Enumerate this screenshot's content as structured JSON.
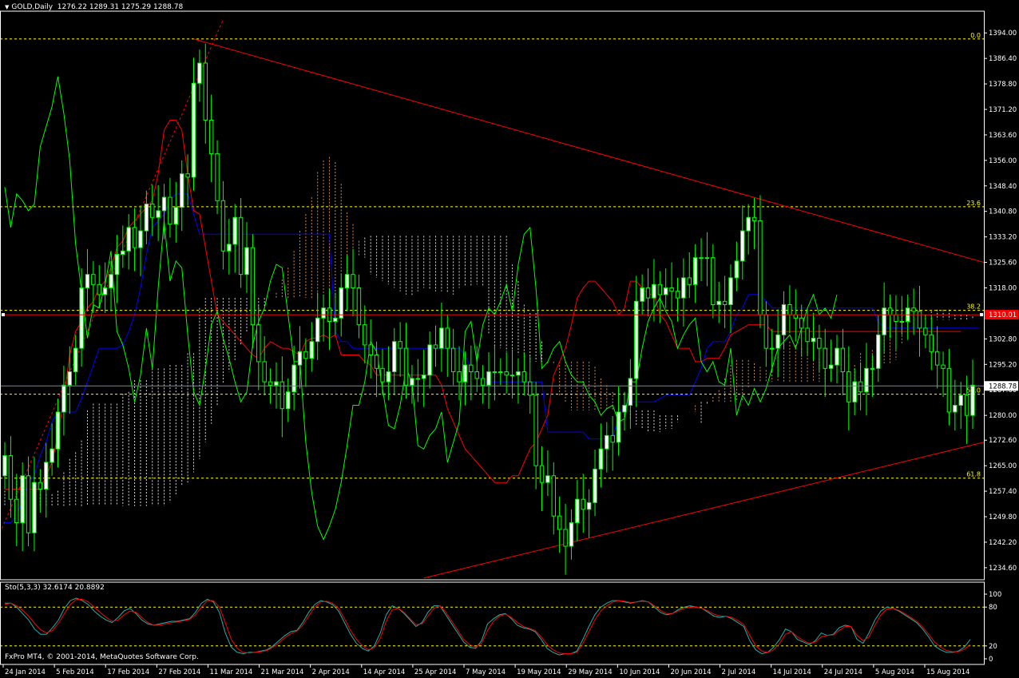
{
  "header": {
    "symbol": "GOLD,Daily",
    "ohlc": "1276.22 1289.31 1275.29 1288.78"
  },
  "subwindow": {
    "label": "Sto(5,3,3) 32.6174 20.8892",
    "levels": [
      "100",
      "80",
      "20",
      "0"
    ]
  },
  "footer": {
    "copyright": "FxPro MT4, © 2001-2014, MetaQuotes Software Corp."
  },
  "colors": {
    "background": "#000000",
    "bull": "#ffffff",
    "bear": "#000000",
    "candle_outline": "#00ff00",
    "tenkan": "#ff0000",
    "kijun": "#0000ff",
    "chikou": "#00ff00",
    "kumo_a": "#f4a460",
    "kumo_b": "#ffffff",
    "fibo": "#ffff00",
    "trendline": "#ff0000",
    "stoch_main": "#20b2aa",
    "stoch_signal": "#ff0000"
  },
  "fibo_levels": [
    {
      "label": "0.0",
      "price": 1392.2
    },
    {
      "label": "23.6",
      "price": 1342.2
    },
    {
      "label": "38.2",
      "price": 1311.3
    },
    {
      "label": "50.0",
      "price": 1286.3
    },
    {
      "label": "61.8",
      "price": 1261.3
    }
  ],
  "price_marks": {
    "red_line": {
      "label": "1310.01",
      "price": 1310.01
    },
    "bid": {
      "label": "1288.78",
      "price": 1288.78
    }
  },
  "chart_data": {
    "type": "candlestick",
    "ylim": [
      1231,
      1400
    ],
    "y_ticks": [
      "1394.00",
      "1386.40",
      "1378.80",
      "1371.20",
      "1363.60",
      "1356.00",
      "1348.40",
      "1340.80",
      "1333.20",
      "1325.60",
      "1318.00",
      "1310.40",
      "1302.80",
      "1295.20",
      "1287.60",
      "1280.00",
      "1272.60",
      "1265.00",
      "1257.40",
      "1249.80",
      "1242.20",
      "1234.60"
    ],
    "x_ticks": [
      "24 Jan 2014",
      "5 Feb 2014",
      "17 Feb 2014",
      "27 Feb 2014",
      "11 Mar 2014",
      "21 Mar 2014",
      "2 Apr 2014",
      "14 Apr 2014",
      "25 Apr 2014",
      "7 May 2014",
      "19 May 2014",
      "29 May 2014",
      "10 Jun 2014",
      "20 Jun 2014",
      "2 Jul 2014",
      "14 Jul 2014",
      "24 Jul 2014",
      "5 Aug 2014",
      "15 Aug 2014"
    ],
    "close": [
      1268,
      1255,
      1248,
      1262,
      1245,
      1260,
      1258,
      1266,
      1270,
      1281,
      1289,
      1293,
      1300,
      1318,
      1322,
      1319,
      1316,
      1318,
      1322,
      1328,
      1329,
      1336,
      1330,
      1335,
      1343,
      1339,
      1341,
      1345,
      1337,
      1342,
      1352,
      1351,
      1379,
      1385,
      1368,
      1358,
      1344,
      1329,
      1331,
      1339,
      1322,
      1330,
      1307,
      1296,
      1290,
      1289,
      1290,
      1282,
      1287,
      1295,
      1299,
      1297,
      1302,
      1309,
      1312,
      1308,
      1309,
      1318,
      1322,
      1318,
      1307,
      1301,
      1298,
      1294,
      1290,
      1293,
      1302,
      1300,
      1289,
      1291,
      1291,
      1292,
      1301,
      1300,
      1306,
      1300,
      1293,
      1290,
      1295,
      1293,
      1291,
      1289,
      1293,
      1293,
      1293,
      1292,
      1292,
      1293,
      1290,
      1286,
      1265,
      1260,
      1262,
      1250,
      1246,
      1241,
      1248,
      1255,
      1252,
      1254,
      1264,
      1270,
      1274,
      1272,
      1281,
      1283,
      1291,
      1314,
      1318,
      1315,
      1319,
      1316,
      1318,
      1317,
      1315,
      1321,
      1319,
      1327,
      1327,
      1327,
      1313,
      1314,
      1313,
      1321,
      1326,
      1335,
      1339,
      1338,
      1310,
      1300,
      1300,
      1304,
      1313,
      1310,
      1309,
      1306,
      1302,
      1303,
      1300,
      1294,
      1295,
      1300,
      1293,
      1284,
      1290,
      1287,
      1294,
      1294,
      1304,
      1312,
      1310,
      1308,
      1308,
      1312,
      1311,
      1306,
      1304,
      1299,
      1295,
      1294,
      1281,
      1283,
      1286,
      1280,
      1289
    ],
    "tenkan": [
      1258,
      1258,
      1258,
      1258,
      1258,
      1258,
      1258,
      1262,
      1266,
      1274,
      1285,
      1298,
      1305,
      1308,
      1312,
      1314,
      1318,
      1320,
      1324,
      1330,
      1332,
      1336,
      1338,
      1340,
      1342,
      1344,
      1352,
      1365,
      1368,
      1368,
      1365,
      1352,
      1341,
      1340,
      1330,
      1320,
      1310,
      1308,
      1306,
      1304,
      1302,
      1300,
      1298,
      1297,
      1300,
      1302,
      1301,
      1300,
      1300,
      1299,
      1298,
      1302,
      1303,
      1303,
      1304,
      1303,
      1304,
      1298,
      1298,
      1298,
      1298,
      1296,
      1295,
      1292,
      1292,
      1292,
      1292,
      1292,
      1292,
      1292,
      1292,
      1292,
      1292,
      1292,
      1289,
      1282,
      1278,
      1274,
      1270,
      1268,
      1266,
      1264,
      1262,
      1260,
      1260,
      1260,
      1262,
      1262,
      1266,
      1270,
      1272,
      1276,
      1280,
      1292,
      1296,
      1300,
      1307,
      1315,
      1318,
      1320,
      1320,
      1318,
      1316,
      1314,
      1310,
      1312,
      1320,
      1320,
      1318,
      1316,
      1316,
      1310,
      1308,
      1304,
      1300,
      1300,
      1300,
      1296,
      1296,
      1297,
      1297,
      1297,
      1300,
      1304,
      1305,
      1306,
      1307,
      1307,
      1307,
      1307,
      1305,
      1305,
      1305,
      1305,
      1305,
      1305,
      1305,
      1305,
      1305,
      1305,
      1305,
      1305,
      1305,
      1305,
      1305,
      1305,
      1305,
      1305,
      1305,
      1305,
      1305,
      1305,
      1305,
      1305,
      1305,
      1305,
      1305,
      1305,
      1305,
      1305,
      1305,
      1305,
      1305
    ],
    "kijun": [
      1248,
      1248,
      1250,
      1255,
      1260,
      1262,
      1268,
      1272,
      1278,
      1281,
      1281,
      1281,
      1281,
      1285,
      1290,
      1295,
      1300,
      1300,
      1300,
      1300,
      1301,
      1305,
      1310,
      1318,
      1328,
      1336,
      1338,
      1340,
      1344,
      1346,
      1346,
      1346,
      1340,
      1334,
      1334,
      1334,
      1334,
      1334,
      1334,
      1334,
      1334,
      1334,
      1334,
      1334,
      1334,
      1334,
      1334,
      1334,
      1334,
      1334,
      1334,
      1334,
      1334,
      1334,
      1334,
      1334,
      1305,
      1302,
      1302,
      1300,
      1300,
      1300,
      1300,
      1300,
      1300,
      1300,
      1300,
      1300,
      1300,
      1300,
      1300,
      1300,
      1300,
      1300,
      1300,
      1300,
      1300,
      1300,
      1298,
      1294,
      1292,
      1290,
      1290,
      1290,
      1290,
      1290,
      1290,
      1290,
      1290,
      1290,
      1290,
      1290,
      1275,
      1275,
      1275,
      1275,
      1275,
      1275,
      1275,
      1273,
      1273,
      1273,
      1273,
      1273,
      1280,
      1283,
      1284,
      1284,
      1284,
      1284,
      1284,
      1285,
      1286,
      1286,
      1286,
      1286,
      1286,
      1290,
      1294,
      1300,
      1302,
      1302,
      1302,
      1305,
      1310,
      1312,
      1316,
      1316,
      1316,
      1314,
      1312,
      1312,
      1312,
      1312,
      1312,
      1312,
      1312,
      1312,
      1312,
      1312,
      1312,
      1312,
      1312,
      1312,
      1312,
      1312,
      1312,
      1312,
      1308,
      1306,
      1306,
      1306,
      1306,
      1306,
      1306,
      1306,
      1306,
      1306,
      1306,
      1306,
      1306,
      1306,
      1306,
      1306,
      1306,
      1306
    ],
    "chikou": [
      1348,
      1336,
      1346,
      1344,
      1341,
      1343,
      1360,
      1366,
      1372,
      1381,
      1370,
      1356,
      1331,
      1317,
      1303,
      1313,
      1312,
      1319,
      1329,
      1305,
      1301,
      1294,
      1284,
      1292,
      1306,
      1294,
      1318,
      1338,
      1320,
      1326,
      1324,
      1304,
      1287,
      1283,
      1294,
      1307,
      1311,
      1303,
      1297,
      1290,
      1284,
      1287,
      1301,
      1308,
      1312,
      1320,
      1325,
      1324,
      1310,
      1296,
      1296,
      1272,
      1257,
      1247,
      1243,
      1247,
      1252,
      1260,
      1271,
      1283,
      1283,
      1290,
      1302,
      1299,
      1288,
      1277,
      1276,
      1283,
      1294,
      1290,
      1271,
      1270,
      1274,
      1276,
      1281,
      1266,
      1272,
      1278,
      1305,
      1308,
      1296,
      1307,
      1312,
      1310,
      1314,
      1319,
      1311,
      1325,
      1334,
      1336,
      1318,
      1294,
      1296,
      1300,
      1302,
      1296,
      1292,
      1290,
      1290,
      1286,
      1284,
      1280,
      1282,
      1283,
      1278,
      1279,
      1290,
      1290,
      1300,
      1308,
      1312,
      1315,
      1311,
      1308,
      1300,
      1304,
      1307,
      1309,
      1296,
      1293,
      1296,
      1290,
      1289,
      1300,
      1280,
      1286,
      1283,
      1288,
      1284,
      1288,
      1294,
      1300,
      1302,
      1304,
      1300,
      1306,
      1312,
      1316,
      1310,
      1312,
      1309,
      1316
    ],
    "stoch_main": [
      86,
      86,
      80,
      70,
      60,
      46,
      38,
      38,
      48,
      60,
      78,
      90,
      94,
      90,
      84,
      74,
      66,
      60,
      56,
      64,
      74,
      78,
      70,
      60,
      54,
      52,
      54,
      56,
      58,
      58,
      60,
      62,
      72,
      86,
      92,
      88,
      72,
      40,
      18,
      10,
      8,
      10,
      10,
      12,
      14,
      20,
      28,
      36,
      42,
      44,
      56,
      72,
      84,
      90,
      88,
      84,
      74,
      56,
      38,
      24,
      16,
      12,
      20,
      40,
      68,
      82,
      78,
      70,
      60,
      50,
      56,
      72,
      82,
      82,
      68,
      54,
      40,
      26,
      18,
      16,
      28,
      54,
      62,
      68,
      70,
      62,
      52,
      48,
      46,
      42,
      30,
      16,
      10,
      6,
      8,
      8,
      12,
      30,
      50,
      68,
      80,
      86,
      90,
      90,
      88,
      86,
      88,
      90,
      88,
      80,
      72,
      68,
      70,
      76,
      80,
      82,
      80,
      78,
      72,
      66,
      64,
      66,
      62,
      56,
      50,
      28,
      14,
      8,
      10,
      18,
      30,
      46,
      42,
      30,
      26,
      22,
      28,
      40,
      36,
      38,
      48,
      52,
      50,
      30,
      24,
      40,
      60,
      74,
      80,
      78,
      74,
      68,
      62,
      56,
      46,
      34,
      20,
      14,
      10,
      10,
      12,
      18,
      30
    ],
    "stoch_signal": [
      84,
      86,
      82,
      75,
      66,
      55,
      45,
      40,
      44,
      55,
      70,
      84,
      92,
      92,
      88,
      80,
      72,
      64,
      58,
      60,
      68,
      74,
      72,
      64,
      56,
      52,
      52,
      54,
      56,
      57,
      59,
      61,
      68,
      80,
      90,
      90,
      80,
      56,
      30,
      16,
      10,
      9,
      10,
      11,
      13,
      18,
      25,
      33,
      39,
      43,
      52,
      66,
      80,
      88,
      89,
      86,
      78,
      62,
      44,
      30,
      20,
      14,
      17,
      32,
      58,
      76,
      78,
      72,
      62,
      53,
      54,
      66,
      78,
      82,
      72,
      58,
      44,
      30,
      22,
      18,
      24,
      44,
      58,
      66,
      69,
      64,
      56,
      50,
      47,
      44,
      34,
      22,
      14,
      9,
      8,
      8,
      10,
      24,
      42,
      60,
      74,
      82,
      88,
      90,
      89,
      87,
      88,
      89,
      88,
      82,
      75,
      70,
      70,
      74,
      78,
      80,
      80,
      78,
      74,
      69,
      66,
      66,
      64,
      59,
      53,
      36,
      20,
      12,
      10,
      14,
      24,
      38,
      42,
      34,
      28,
      24,
      26,
      34,
      36,
      37,
      44,
      50,
      50,
      36,
      28,
      34,
      52,
      68,
      77,
      78,
      75,
      70,
      64,
      58,
      49,
      38,
      26,
      18,
      13,
      11,
      11,
      15,
      22
    ]
  }
}
